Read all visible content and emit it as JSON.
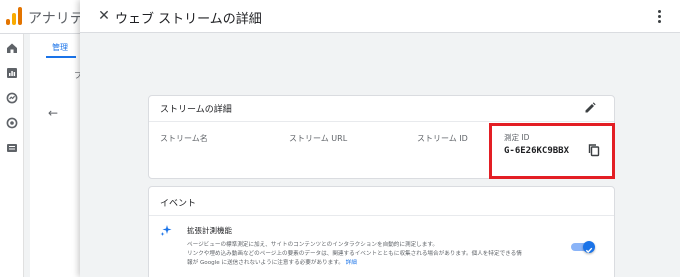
{
  "background": {
    "app_title": "アナリティ",
    "admin_tab": "管理",
    "left_fragment": "プ"
  },
  "panel": {
    "title": "ウェブ ストリームの詳細"
  },
  "stream_details": {
    "title": "ストリームの詳細",
    "fields": {
      "stream_name_label": "ストリーム名",
      "stream_url_label": "ストリーム URL",
      "stream_id_label": "ストリーム ID",
      "measurement_id_label": "測定 ID",
      "measurement_id_value": "G-6E26KC9BBX"
    }
  },
  "events": {
    "title": "イベント",
    "enhanced_measurement": {
      "title": "拡張計測機能",
      "desc_line1": "ページビューの標準測定に加え、サイトのコンテンツとのインタラクションを自動的に測定します。",
      "desc_line2": "リンクや埋め込み動画などのページ上の要素のデータは、関連するイベントとともに収集される場合があります。個人を特定できる情",
      "desc_line3": "報が Google に送信されないように注意する必要があります。",
      "link": "詳細",
      "enabled": true
    }
  },
  "colors": {
    "accent": "#1a73e8",
    "highlight_border": "#e31e24",
    "ga_orange": "#e37400",
    "ga_yellow": "#f9ab00"
  }
}
